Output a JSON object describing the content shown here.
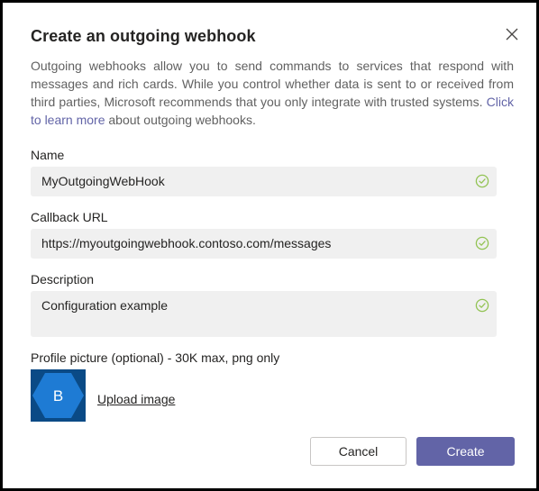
{
  "dialog": {
    "title": "Create an outgoing webhook",
    "description_text": "Outgoing webhooks allow you to send commands to services that respond with messages and rich cards. While you control whether data is sent to or received from third parties, Microsoft recommends that you only integrate with trusted systems.",
    "description_link": "Click to learn more",
    "description_suffix": "about outgoing webhooks."
  },
  "form": {
    "name_label": "Name",
    "name_value": "MyOutgoingWebHook",
    "callback_label": "Callback URL",
    "callback_value": "https://myoutgoingwebhook.contoso.com/messages",
    "description_label": "Description",
    "description_value": "Configuration example",
    "picture_label": "Profile picture (optional) - 30K max, png only",
    "avatar_letter": "B",
    "upload_label": "Upload image"
  },
  "buttons": {
    "cancel": "Cancel",
    "create": "Create"
  },
  "colors": {
    "accent": "#6264a7",
    "valid_check": "#92c353",
    "avatar_bg": "#0a4a86",
    "avatar_hex": "#1e7bd4"
  },
  "icons": {
    "close": "close-icon",
    "valid": "check-circle-icon",
    "avatar": "hexagon-avatar-icon"
  }
}
